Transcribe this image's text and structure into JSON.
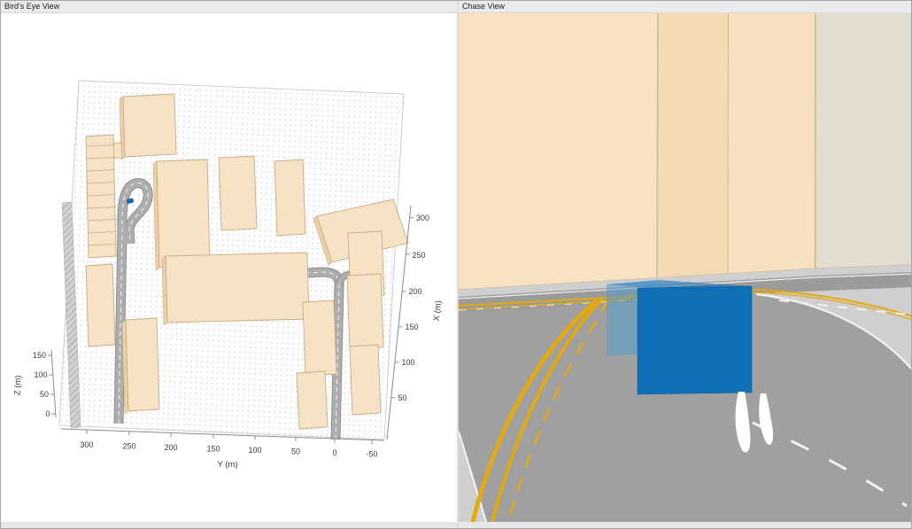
{
  "panels": {
    "birds_eye": {
      "title": "Bird's Eye View",
      "axes": {
        "x": {
          "label": "X (m)",
          "ticks": [
            "300",
            "250",
            "200",
            "150",
            "100",
            "50"
          ]
        },
        "y": {
          "label": "Y (m)",
          "ticks": [
            "300",
            "250",
            "200",
            "150",
            "100",
            "50",
            "0",
            "-50"
          ]
        },
        "z": {
          "label": "Z (m)",
          "ticks": [
            "150",
            "100",
            "50",
            "0"
          ]
        }
      }
    },
    "chase": {
      "title": "Chase View"
    }
  },
  "colors": {
    "panel_bg": "#e7e7e7",
    "titlebar_bg": "#ebebeb",
    "title_text": "#1a1a1a",
    "plot_bg": "#ffffff",
    "grid_dot": "#c8c8c8",
    "axis_line": "#8a8a8a",
    "axis_text": "#3c3c3c",
    "building_fill": "#f6e2c4",
    "building_side": "#ecd0a8",
    "building_edge": "#c9ab83",
    "road_fill": "#aeaeae",
    "road_edge": "#8d8d8d",
    "lane_white": "#f2f2f2",
    "lane_yellow": "#e2aa10",
    "ego_blue": "#0b6fb8",
    "ego_blue_light": "#4f9ace",
    "sky": "#d9d9d9",
    "sidewalk": "#cfcfcf",
    "chase_road": "#a0a0a0",
    "distant_road": "#9b9b9b",
    "wall_a": "#f7e3c3",
    "wall_b": "#f2dab5",
    "wall_c": "#f6e1c0",
    "wall_d": "#e3ddd0"
  }
}
